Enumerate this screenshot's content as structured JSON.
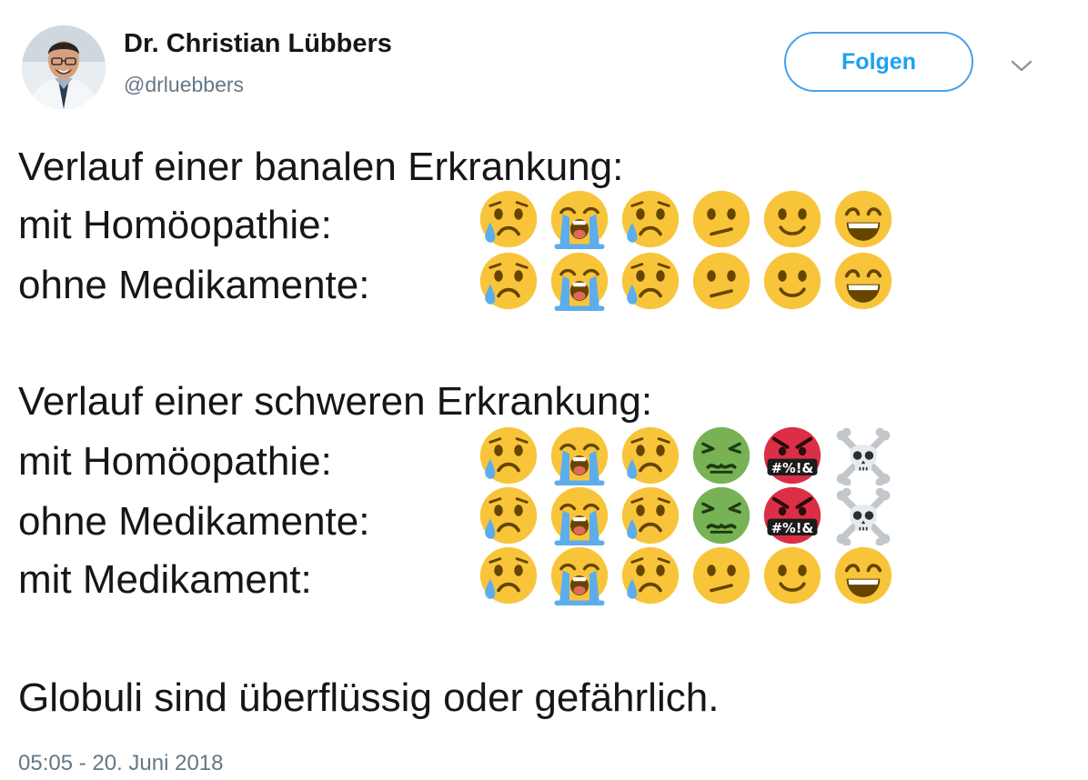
{
  "author": {
    "name": "Dr. Christian Lübbers",
    "handle": "@drluebbers"
  },
  "follow_label": "Folgen",
  "tweet": {
    "banal_heading": "Verlauf einer banalen Erkrankung:",
    "banal_rows": [
      {
        "label": "mit Homöopathie:",
        "emojis": [
          "sad-tear-face-icon",
          "loudly-crying-face-icon",
          "sad-tear-face-icon",
          "confused-face-icon",
          "slightly-smiling-face-icon",
          "grinning-face-icon"
        ]
      },
      {
        "label": "ohne Medikamente:",
        "emojis": [
          "sad-tear-face-icon",
          "loudly-crying-face-icon",
          "sad-tear-face-icon",
          "confused-face-icon",
          "slightly-smiling-face-icon",
          "grinning-face-icon"
        ]
      }
    ],
    "severe_heading": "Verlauf einer schweren Erkrankung:",
    "severe_rows": [
      {
        "label": "mit Homöopathie:",
        "emojis": [
          "sad-tear-face-icon",
          "loudly-crying-face-icon",
          "sad-tear-face-icon",
          "nauseated-face-icon",
          "cursing-face-icon",
          "skull-crossbones-icon"
        ]
      },
      {
        "label": "ohne Medikamente:",
        "emojis": [
          "sad-tear-face-icon",
          "loudly-crying-face-icon",
          "sad-tear-face-icon",
          "nauseated-face-icon",
          "cursing-face-icon",
          "skull-crossbones-icon"
        ]
      },
      {
        "label": "mit Medikament:",
        "emojis": [
          "sad-tear-face-icon",
          "loudly-crying-face-icon",
          "sad-tear-face-icon",
          "confused-face-icon",
          "slightly-smiling-face-icon",
          "grinning-face-icon"
        ]
      }
    ],
    "conclusion": "Globuli sind überflüssig oder gefährlich.",
    "cursing_symbols": "#%!&"
  },
  "timestamp": "05:05 - 20. Juni 2018",
  "colors": {
    "emoji_yellow": "#f8c53a",
    "tear_blue": "#5dadec",
    "nauseated_green": "#77b255",
    "cursing_red": "#da2f47",
    "follow_blue": "#1da1f2",
    "muted_text": "#657786"
  }
}
